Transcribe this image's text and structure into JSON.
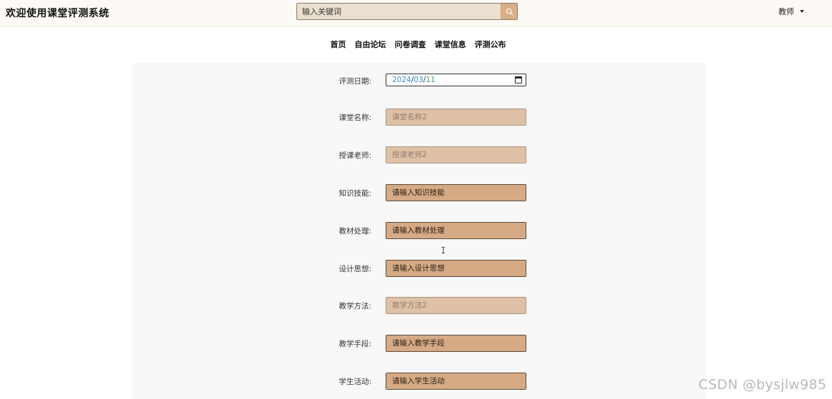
{
  "header": {
    "site_title": "欢迎使用课堂评测系统",
    "search_placeholder": "输入关键词",
    "user_label": "教师"
  },
  "nav": [
    "首页",
    "自由论坛",
    "问卷调查",
    "课堂信息",
    "评测公布"
  ],
  "form": {
    "date": {
      "label": "评测日期:",
      "year": "2024",
      "month": "03",
      "day": "11"
    },
    "fields": [
      {
        "label": "课堂名称:",
        "placeholder": "课堂名称2",
        "editable": false
      },
      {
        "label": "授课老师:",
        "placeholder": "授课老师2",
        "editable": false
      },
      {
        "label": "知识技能:",
        "placeholder": "请输入知识技能",
        "editable": true
      },
      {
        "label": "教材处理:",
        "placeholder": "请输入教材处理",
        "editable": true
      },
      {
        "label": "设计思想:",
        "placeholder": "请输入设计思想",
        "editable": true
      },
      {
        "label": "教学方法:",
        "placeholder": "教学方法2",
        "editable": false
      },
      {
        "label": "教学手段:",
        "placeholder": "请输入教学手段",
        "editable": true
      },
      {
        "label": "学生活动:",
        "placeholder": "请输入学生活动",
        "editable": true
      }
    ]
  },
  "watermark": "CSDN @bysjlw985",
  "colors": {
    "accent": "#d6aa84",
    "readonly": "#dfc1a6",
    "header_bg": "#fdfaf6",
    "panel_bg": "#f8f8f8"
  }
}
